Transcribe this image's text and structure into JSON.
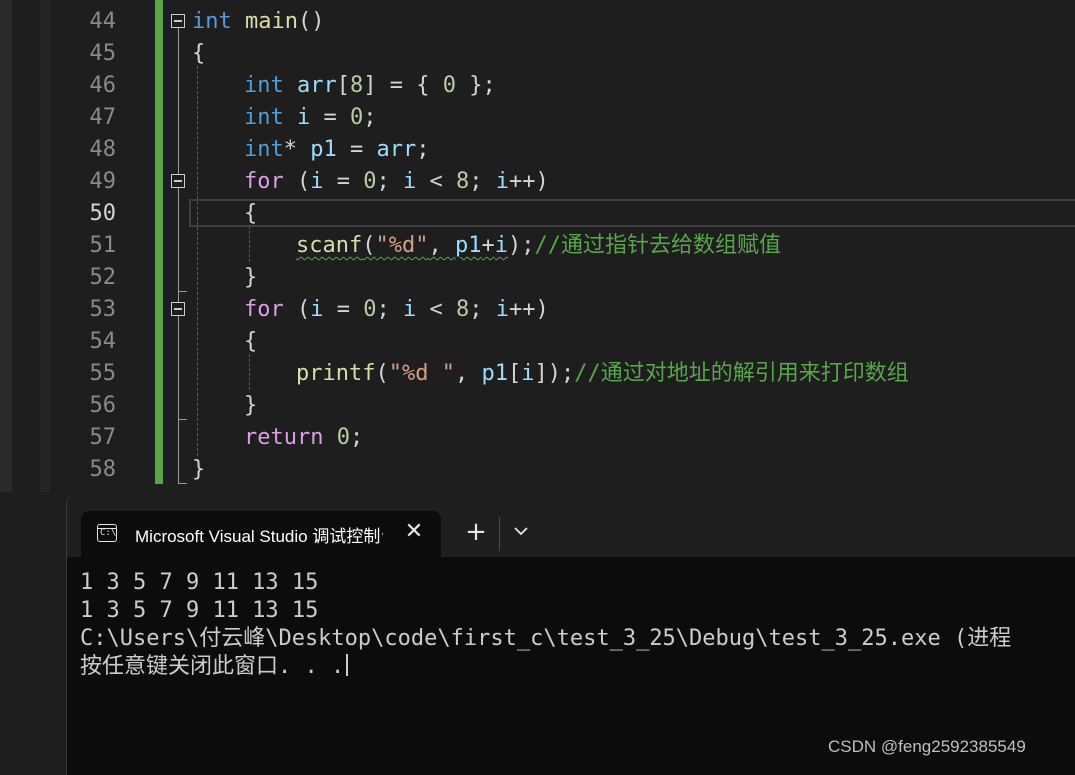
{
  "editor": {
    "line_numbers": [
      "44",
      "45",
      "46",
      "47",
      "48",
      "49",
      "50",
      "51",
      "52",
      "53",
      "54",
      "55",
      "56",
      "57",
      "58"
    ],
    "current_line": "50",
    "code": {
      "l44_kw": "int",
      "l44_fn": "main",
      "l44_rest": "()",
      "l45": "{",
      "l46_kw": "int",
      "l46_var": "arr",
      "l46_a": "[",
      "l46_num": "8",
      "l46_b": "] = { ",
      "l46_num2": "0",
      "l46_c": " };",
      "l47_kw": "int",
      "l47_var": "i",
      "l47_a": " = ",
      "l47_num": "0",
      "l47_b": ";",
      "l48_kw": "int",
      "l48_a": "* ",
      "l48_var": "p1",
      "l48_b": " = ",
      "l48_var2": "arr",
      "l48_c": ";",
      "l49_kw": "for",
      "l49_a": " (",
      "l49_v1": "i",
      "l49_b": " = ",
      "l49_n1": "0",
      "l49_c": "; ",
      "l49_v2": "i",
      "l49_d": " < ",
      "l49_n2": "8",
      "l49_e": "; ",
      "l49_v3": "i",
      "l49_f": "++)",
      "l50": "{",
      "l51_fn": "scanf",
      "l51_a": "(",
      "l51_str": "\"%d\"",
      "l51_b": ", ",
      "l51_var": "p1",
      "l51_c": "+",
      "l51_var2": "i",
      "l51_d": ");",
      "l51_cmt": "//通过指针去给数组赋值",
      "l52": "}",
      "l53_kw": "for",
      "l53_a": " (",
      "l53_v1": "i",
      "l53_b": " = ",
      "l53_n1": "0",
      "l53_c": "; ",
      "l53_v2": "i",
      "l53_d": " < ",
      "l53_n2": "8",
      "l53_e": "; ",
      "l53_v3": "i",
      "l53_f": "++)",
      "l54": "{",
      "l55_fn": "printf",
      "l55_a": "(",
      "l55_str": "\"%d \"",
      "l55_b": ", ",
      "l55_var": "p1",
      "l55_c": "[",
      "l55_var2": "i",
      "l55_d": "]);",
      "l55_cmt": "//通过对地址的解引用来打印数组",
      "l56": "}",
      "l57_kw": "return",
      "l57_a": " ",
      "l57_num": "0",
      "l57_b": ";",
      "l58": "}"
    }
  },
  "terminal": {
    "tab_title": "Microsoft Visual Studio 调试控制台",
    "tab_icon_text": "C:\\",
    "close_glyph": "✕",
    "new_tab_glyph": "+",
    "lines": [
      "1 3 5 7 9 11 13 15",
      "1 3 5 7 9 11 13 15",
      "C:\\Users\\付云峰\\Desktop\\code\\first_c\\test_3_25\\Debug\\test_3_25.exe (进程",
      "按任意键关闭此窗口. . ."
    ]
  },
  "watermark": "CSDN @feng2592385549",
  "colors": {
    "keyword": "#569cd6",
    "control": "#d8a0df",
    "function": "#dcdcaa",
    "variable": "#9cdcfe",
    "number": "#b5cea8",
    "string": "#d69d85",
    "comment": "#57a64a"
  }
}
